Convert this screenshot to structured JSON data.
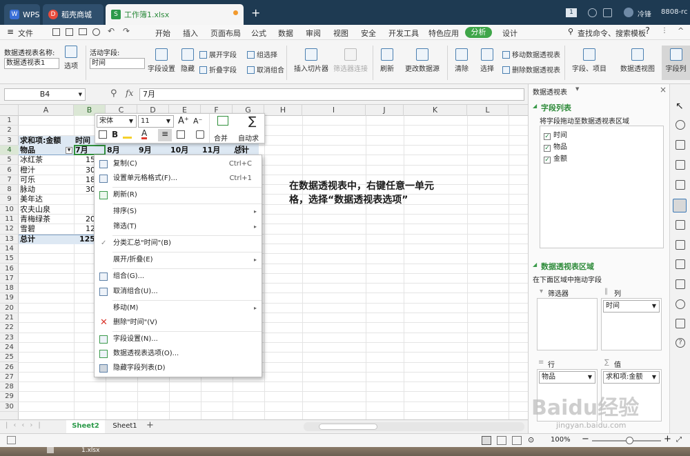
{
  "tabs": [
    {
      "label": "WPS"
    },
    {
      "label": "稻壳商城"
    },
    {
      "label": "工作簿1.xlsx"
    }
  ],
  "titlebar": {
    "new_tab": "+",
    "badge": "1",
    "user": "冷锋",
    "version": "8808-rc"
  },
  "menu": {
    "file": "文件",
    "items": [
      "开始",
      "插入",
      "页面布局",
      "公式",
      "数据",
      "审阅",
      "视图",
      "安全",
      "开发工具",
      "特色应用",
      "分析",
      "设计"
    ],
    "search": "查找命令、搜索模板",
    "help": "?"
  },
  "ribbon": {
    "pivot_name_label": "数据透视表名称:",
    "pivot_name_value": "数据透视表1",
    "options": "选项",
    "active_field_label": "活动字段:",
    "active_field_value": "时间",
    "field_settings": "字段设置",
    "hide": "隐藏",
    "expand_field": "展开字段",
    "collapse_field": "折叠字段",
    "group_select": "组选择",
    "ungroup": "取消组合",
    "insert_slicer": "插入切片器",
    "filter_conn": "筛选器连接",
    "refresh": "刷新",
    "change_source": "更改数据源",
    "clear": "清除",
    "select": "选择",
    "move_pivot": "移动数据透视表",
    "delete_pivot": "删除数据透视表",
    "fields_items": "字段、项目",
    "pivot_chart": "数据透视图",
    "field_list": "字段列"
  },
  "formula": {
    "cell_ref": "B4",
    "fx": "fx",
    "value": "7月"
  },
  "columns": [
    "A",
    "B",
    "C",
    "D",
    "E",
    "F",
    "G",
    "H",
    "I",
    "J",
    "K",
    "L"
  ],
  "rows": [
    "1",
    "2",
    "3",
    "4",
    "5",
    "6",
    "7",
    "8",
    "9",
    "10",
    "11",
    "12",
    "13",
    "14",
    "15",
    "16",
    "17",
    "18",
    "19",
    "20",
    "21",
    "22",
    "23",
    "24",
    "25",
    "26",
    "27",
    "28",
    "29",
    "30"
  ],
  "sheet": {
    "a3": "求和项:金额",
    "b3": "时间",
    "a4": "物品",
    "b4": "7月",
    "c4": "8月",
    "d4": "9月",
    "e4": "10月",
    "f4": "11月",
    "g4": "总计",
    "items": [
      "冰红茶",
      "橙汁",
      "可乐",
      "脉动",
      "美年达",
      "农夫山泉",
      "青梅绿茶",
      "雪碧"
    ],
    "b_values": [
      "15",
      "30",
      "18",
      "30",
      "",
      "",
      "20",
      "12"
    ],
    "total_label": "总计",
    "total_b": "125"
  },
  "minitoolbar": {
    "font": "宋体",
    "size": "11",
    "merge": "合并",
    "autosum": "自动求和"
  },
  "context_menu": [
    {
      "label": "复制(C)",
      "shortcut": "Ctrl+C"
    },
    {
      "label": "设置单元格格式(F)...",
      "shortcut": "Ctrl+1"
    },
    {
      "label": "刷新(R)",
      "shortcut": ""
    },
    {
      "label": "排序(S)",
      "shortcut": ""
    },
    {
      "label": "筛选(T)",
      "shortcut": ""
    },
    {
      "label": "分类汇总\"时间\"(B)",
      "shortcut": ""
    },
    {
      "label": "展开/折叠(E)",
      "shortcut": ""
    },
    {
      "label": "组合(G)...",
      "shortcut": ""
    },
    {
      "label": "取消组合(U)...",
      "shortcut": ""
    },
    {
      "label": "移动(M)",
      "shortcut": ""
    },
    {
      "label": "删除\"时间\"(V)",
      "shortcut": ""
    },
    {
      "label": "字段设置(N)...",
      "shortcut": ""
    },
    {
      "label": "数据透视表选项(O)...",
      "shortcut": ""
    },
    {
      "label": "隐藏字段列表(D)",
      "shortcut": ""
    }
  ],
  "annotation": {
    "line1": "在数据透视表中，右键任意一单元",
    "line2": "格，选择“数据透视表选项”"
  },
  "pane": {
    "title": "数据透视表",
    "field_list_title": "字段列表",
    "drag_hint": "将字段拖动至数据透视表区域",
    "fields": [
      "时间",
      "物品",
      "金额"
    ],
    "area_title": "数据透视表区域",
    "area_hint": "在下面区域中拖动字段",
    "filter_label": "筛选器",
    "column_label": "列",
    "column_value": "时间",
    "row_label": "行",
    "row_value": "物品",
    "value_label": "值",
    "value_value": "求和项:金额"
  },
  "sheets": {
    "active": "Sheet2",
    "other": "Sheet1",
    "add": "+"
  },
  "status": {
    "zoom": "100%"
  },
  "taskbar": {
    "file": "1.xlsx"
  },
  "watermark": {
    "text": "Baidu经验",
    "url": "jingyan.baidu.com"
  }
}
